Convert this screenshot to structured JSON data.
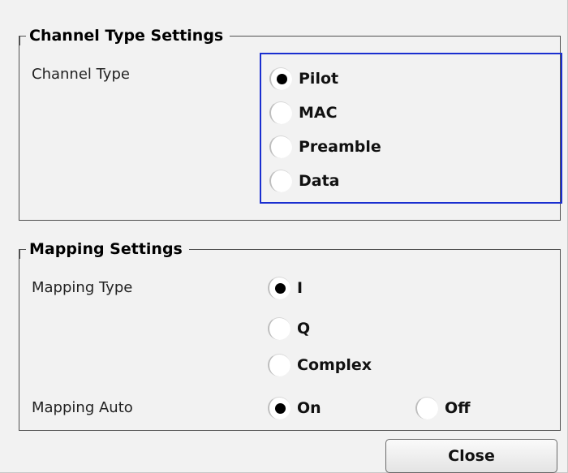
{
  "channel_type_settings": {
    "title": "Channel Type Settings",
    "field_label": "Channel Type",
    "options": [
      {
        "label": "Pilot",
        "checked": true
      },
      {
        "label": "MAC",
        "checked": false
      },
      {
        "label": "Preamble",
        "checked": false
      },
      {
        "label": "Data",
        "checked": false
      }
    ],
    "focus_color": "#1a2fd0"
  },
  "mapping_settings": {
    "title": "Mapping Settings",
    "type_label": "Mapping Type",
    "type_options": [
      {
        "label": "I",
        "checked": true
      },
      {
        "label": "Q",
        "checked": false
      },
      {
        "label": "Complex",
        "checked": false
      }
    ],
    "auto_label": "Mapping Auto",
    "auto_options": [
      {
        "label": "On",
        "checked": true
      },
      {
        "label": "Off",
        "checked": false
      }
    ]
  },
  "close_label": "Close"
}
